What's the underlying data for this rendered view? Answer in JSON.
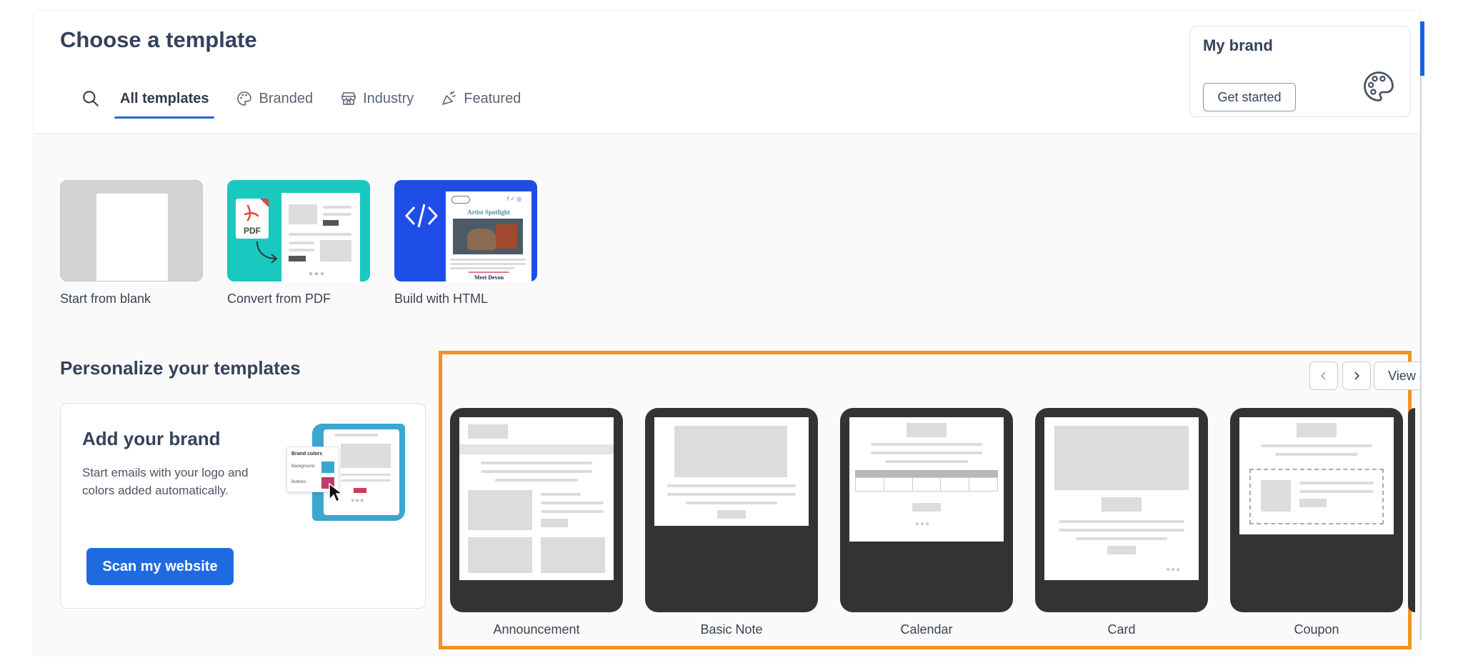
{
  "header": {
    "title": "Choose a template",
    "tabs": [
      {
        "label": "All templates",
        "icon": "none",
        "active": true
      },
      {
        "label": "Branded",
        "icon": "palette-icon",
        "active": false
      },
      {
        "label": "Industry",
        "icon": "storefront-icon",
        "active": false
      },
      {
        "label": "Featured",
        "icon": "megaphone-icon",
        "active": false
      }
    ]
  },
  "my_brand": {
    "title": "My brand",
    "button_label": "Get started"
  },
  "start_options": [
    {
      "label": "Start from blank"
    },
    {
      "label": "Convert from PDF",
      "thumb_text": "PDF"
    },
    {
      "label": "Build with HTML",
      "thumb_title": "Artist Spotlight",
      "thumb_subtitle": "Meet Devon"
    }
  ],
  "personalize": {
    "title": "Personalize your templates",
    "card_title": "Add your brand",
    "card_description": "Start emails with your logo and colors added automatically.",
    "button_label": "Scan my website",
    "illustration": {
      "heading": "Brand colors",
      "row1": "Background",
      "row2": "Buttons"
    }
  },
  "carousel": {
    "view_all_label": "View all",
    "templates": [
      {
        "label": "Announcement"
      },
      {
        "label": "Basic Note"
      },
      {
        "label": "Calendar"
      },
      {
        "label": "Card"
      },
      {
        "label": "Coupon"
      }
    ]
  },
  "colors": {
    "primary": "#1f6ae0",
    "highlight": "#f39223",
    "pdf_bg": "#19c9bf",
    "html_bg": "#1f4ee6",
    "frame": "#333333"
  }
}
